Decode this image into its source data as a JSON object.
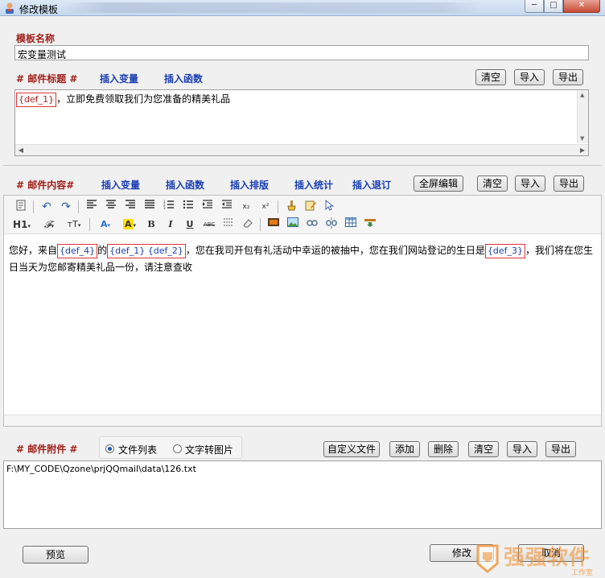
{
  "window": {
    "title": "修改模板",
    "min_symbol": "─",
    "max_symbol": "□",
    "close_symbol": "✕"
  },
  "template_name": {
    "label": "模板名称",
    "value": "宏变量测试"
  },
  "mail_subject": {
    "label": "# 邮件标题 #",
    "insert_variable": "插入变量",
    "insert_function": "插入函数",
    "clear": "清空",
    "import": "导入",
    "export": "导出",
    "token": "{def_1}",
    "text": "，立即免费领取我们为您准备的精美礼品"
  },
  "mail_content": {
    "label": "# 邮件内容# ",
    "insert_variable": "插入变量",
    "insert_function": "插入函数",
    "insert_layout": "插入排版",
    "insert_stats": "插入统计",
    "insert_unsubscribe": "插入退订",
    "fullscreen": "全屏编辑",
    "clear": "清空",
    "import": "导入",
    "export": "导出",
    "toolbar_text": {
      "h1": "H1",
      "font": "𝓕",
      "size": "тT",
      "fontcolor": "A",
      "bgcolor": "A",
      "bold": "B",
      "italic": "I",
      "underline": "U",
      "strike": "ABC",
      "subscript": "x₂",
      "superscript": "x²"
    },
    "body": {
      "p1": "您好，来自",
      "t1": "{def_4}",
      "p2": "的",
      "t2": "{def_1} {def_2}",
      "p3": "，您在我司开包有礼活动中幸运的被抽中，您在我们网站登记的生日是",
      "t3": "{def_3}",
      "p4": "，我们将在您生日当天为您邮寄精美礼品一份，请注意查收"
    }
  },
  "attachment": {
    "label": "# 邮件附件 #",
    "radio_file_list": "文件列表",
    "radio_text_to_image": "文字转图片",
    "custom_file": "自定义文件",
    "add": "添加",
    "delete": "删除",
    "clear": "清空",
    "import": "导入",
    "export": "导出",
    "path": "F:\\MY_CODE\\Qzone\\prjQQmail\\data\\126.txt"
  },
  "footer": {
    "preview": "预览",
    "modify": "修改",
    "cancel": "取消"
  },
  "watermark": {
    "brand": "强强软件",
    "sub": "工作室"
  },
  "colors": {
    "label_red": "#a0201a",
    "link_blue": "#1a3fb4",
    "token_border": "#dd3333"
  }
}
